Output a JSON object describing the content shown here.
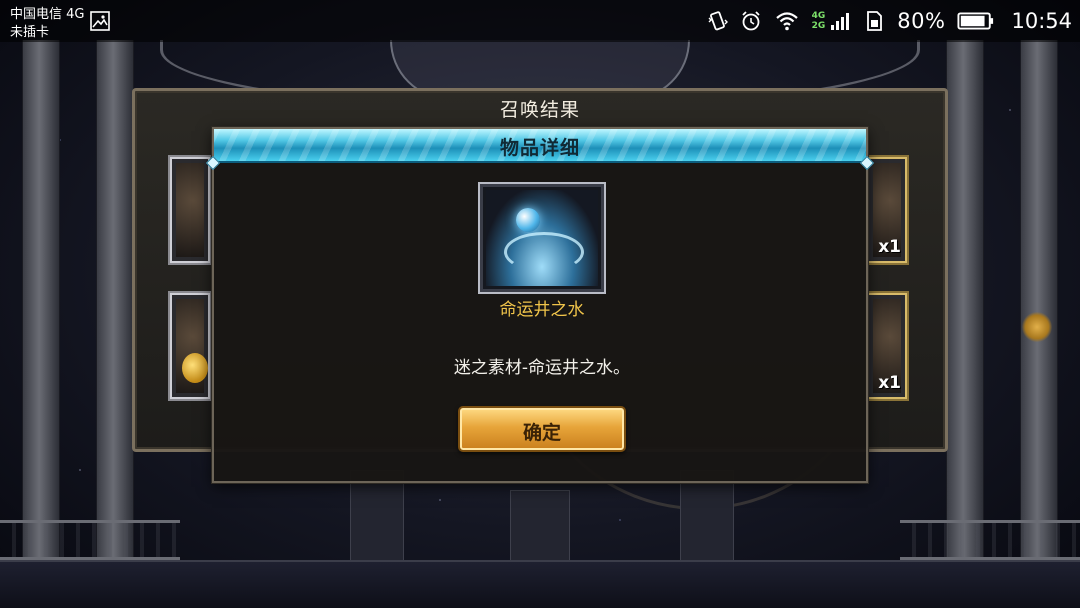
{
  "status_bar": {
    "carrier": "中国电信 4G",
    "sim_status": "未插卡",
    "network_tags": [
      "4G",
      "2G"
    ],
    "battery_percent": "80%",
    "time": "10:54",
    "icons": [
      "image-icon",
      "vibrate-icon",
      "alarm-icon",
      "wifi-icon",
      "signal-icon",
      "sim-icon",
      "battery-icon"
    ]
  },
  "summon_panel": {
    "title": "召唤结果",
    "slots": [
      {
        "quantity": ""
      },
      {
        "quantity": "x1"
      },
      {
        "quantity": ""
      },
      {
        "quantity": "x1"
      }
    ]
  },
  "item_detail": {
    "title": "物品详细",
    "item_name": "命运井之水",
    "item_icon": "water-splash-icon",
    "description": "迷之素材-命运井之水。",
    "confirm_label": "确定"
  },
  "colors": {
    "header_cyan": "#52c8e6",
    "item_name_gold": "#f0c44a",
    "button_orange": "#e7a53a"
  }
}
